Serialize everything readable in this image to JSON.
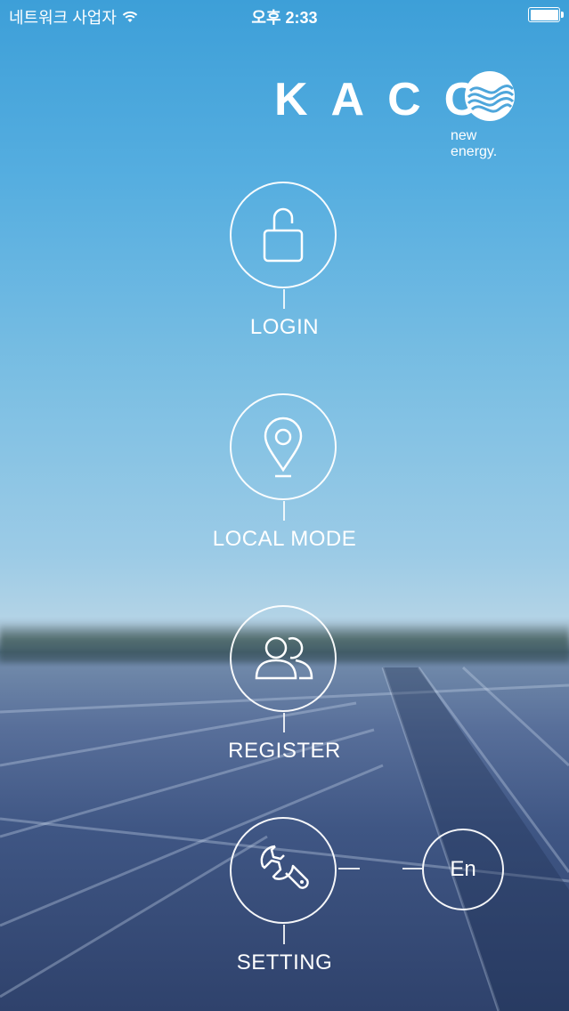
{
  "status_bar": {
    "carrier": "네트워크 사업자",
    "time": "오후 2:33",
    "battery_level": 1.0,
    "wifi_icon": "wifi-icon",
    "battery_icon": "battery-icon"
  },
  "logo": {
    "brand": "KACO",
    "tagline": "new energy.",
    "mark_icon": "kaco-wave-logo"
  },
  "menu": [
    {
      "label": "LOGIN",
      "icon": "unlocked-padlock-icon"
    },
    {
      "label": "LOCAL MODE",
      "icon": "location-pin-icon"
    },
    {
      "label": "REGISTER",
      "icon": "users-icon"
    },
    {
      "label": "SETTING",
      "icon": "wrench-icon"
    }
  ],
  "language": {
    "label": "En"
  },
  "colors": {
    "sky_top": "#3d9fd8",
    "sky_mid": "#9ccbe6",
    "panels": "#3f5684"
  }
}
